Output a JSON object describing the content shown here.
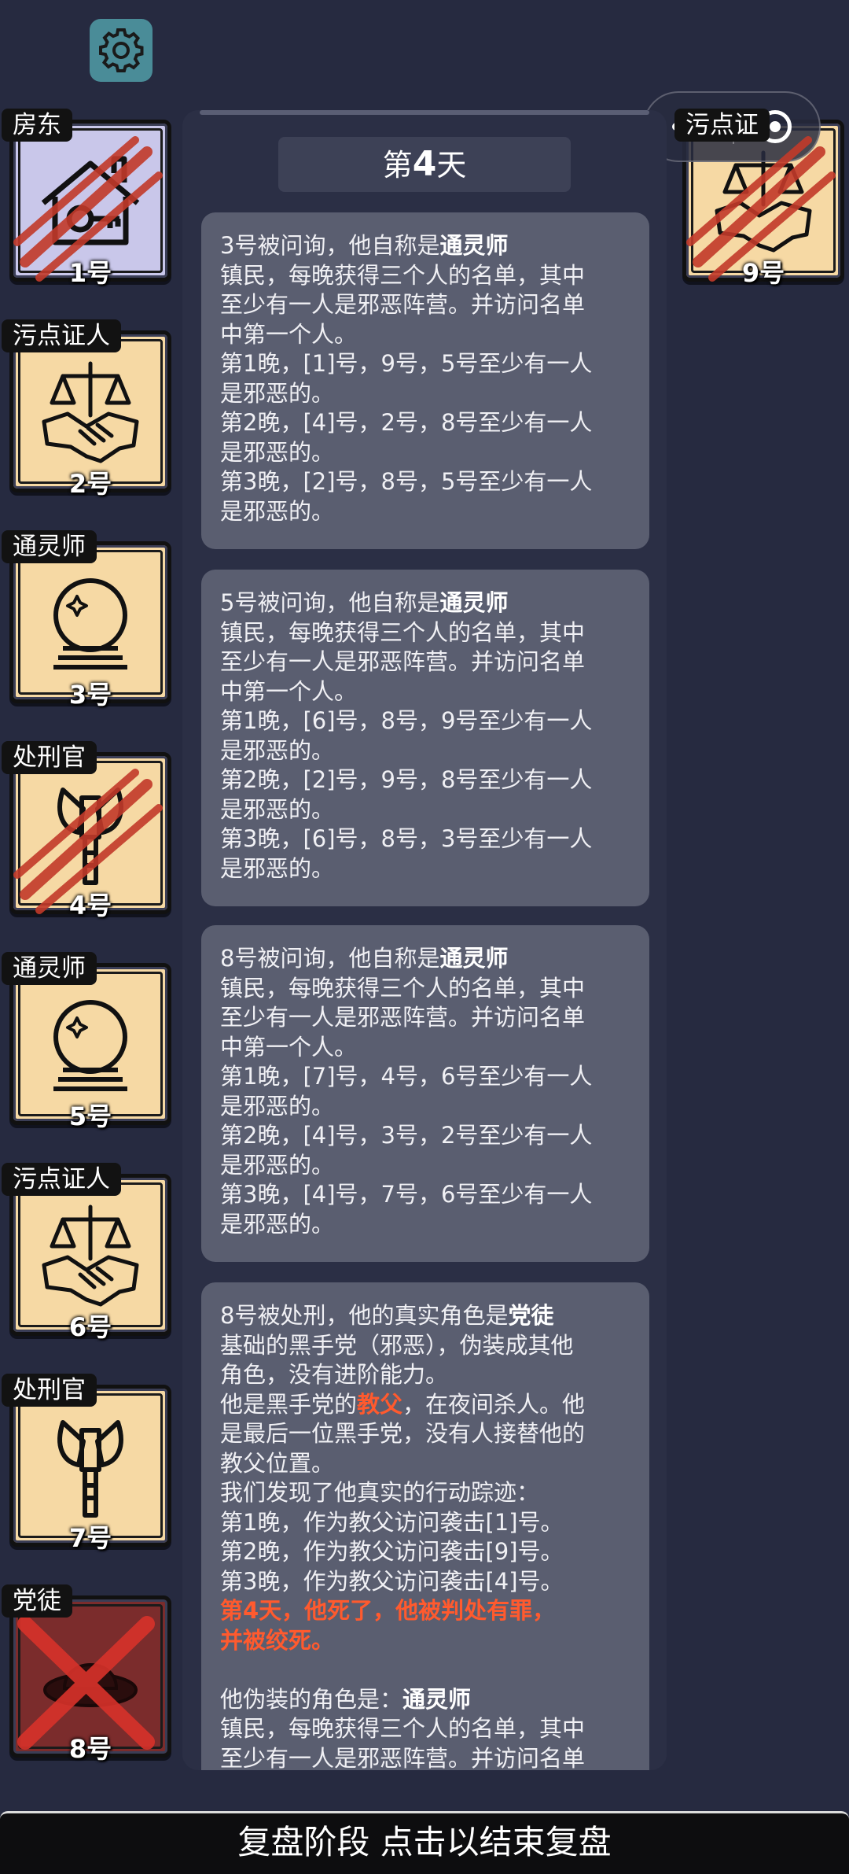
{
  "day_banner": {
    "prefix": "第",
    "day": "4",
    "suffix": "天"
  },
  "players": [
    {
      "role": "房东",
      "num": "1号",
      "icon": "house-key-icon",
      "dead": true
    },
    {
      "role": "污点证人",
      "num": "2号",
      "icon": "scales-handshake-icon",
      "dead": false
    },
    {
      "role": "通灵师",
      "num": "3号",
      "icon": "crystal-ball-icon",
      "dead": false
    },
    {
      "role": "处刑官",
      "num": "4号",
      "icon": "axe-icon",
      "dead": true
    },
    {
      "role": "通灵师",
      "num": "5号",
      "icon": "crystal-ball-icon",
      "dead": false
    },
    {
      "role": "污点证人",
      "num": "6号",
      "icon": "scales-handshake-icon",
      "dead": false
    },
    {
      "role": "处刑官",
      "num": "7号",
      "icon": "axe-icon",
      "dead": false
    },
    {
      "role": "党徒",
      "num": "8号",
      "icon": "hat-icon",
      "dead": true
    },
    {
      "role": "污点证",
      "num": "9号",
      "icon": "scales-handshake-icon",
      "dead": true
    }
  ],
  "messages": [
    {
      "lines": [
        {
          "pre": "3号被问询，他自称是",
          "bold": "通灵师"
        },
        {
          "text": "镇民，每晚获得三个人的名单，其中"
        },
        {
          "text": "至少有一人是邪恶阵营。并访问名单"
        },
        {
          "text": "中第一个人。"
        },
        {
          "text": "第1晚，[1]号，9号，5号至少有一人"
        },
        {
          "text": "是邪恶的。"
        },
        {
          "text": "第2晚，[4]号，2号，8号至少有一人"
        },
        {
          "text": "是邪恶的。"
        },
        {
          "text": "第3晚，[2]号，8号，5号至少有一人"
        },
        {
          "text": "是邪恶的。"
        }
      ]
    },
    {
      "lines": [
        {
          "pre": "5号被问询，他自称是",
          "bold": "通灵师"
        },
        {
          "text": "镇民，每晚获得三个人的名单，其中"
        },
        {
          "text": "至少有一人是邪恶阵营。并访问名单"
        },
        {
          "text": "中第一个人。"
        },
        {
          "text": "第1晚，[6]号，8号，9号至少有一人"
        },
        {
          "text": "是邪恶的。"
        },
        {
          "text": "第2晚，[2]号，9号，8号至少有一人"
        },
        {
          "text": "是邪恶的。"
        },
        {
          "text": "第3晚，[6]号，8号，3号至少有一人"
        },
        {
          "text": "是邪恶的。"
        }
      ]
    },
    {
      "lines": [
        {
          "pre": "8号被问询，他自称是",
          "bold": "通灵师"
        },
        {
          "text": "镇民，每晚获得三个人的名单，其中"
        },
        {
          "text": "至少有一人是邪恶阵营。并访问名单"
        },
        {
          "text": "中第一个人。"
        },
        {
          "text": "第1晚，[7]号，4号，6号至少有一人"
        },
        {
          "text": "是邪恶的。"
        },
        {
          "text": "第2晚，[4]号，3号，2号至少有一人"
        },
        {
          "text": "是邪恶的。"
        },
        {
          "text": "第3晚，[4]号，7号，6号至少有一人"
        },
        {
          "text": "是邪恶的。"
        }
      ]
    },
    {
      "lines": [
        {
          "pre": "8号被处刑，他的真实角色是",
          "bold": "党徒"
        },
        {
          "text": "基础的黑手党（邪恶），伪装成其他"
        },
        {
          "text": "角色，没有进阶能力。"
        },
        {
          "pre": "他是黑手党的",
          "red": "教父",
          "post": "，在夜间杀人。他"
        },
        {
          "text": "是最后一位黑手党，没有人接替他的"
        },
        {
          "text": "教父位置。"
        },
        {
          "text": "我们发现了他真实的行动踪迹："
        },
        {
          "text": "第1晚，作为教父访问袭击[1]号。"
        },
        {
          "text": "第2晚，作为教父访问袭击[9]号。"
        },
        {
          "text": "第3晚，作为教父访问袭击[4]号。"
        },
        {
          "red": "第4天，他死了，他被判处有罪，"
        },
        {
          "red": "并被绞死。"
        },
        {
          "text": ""
        },
        {
          "pre": "他伪装的角色是：",
          "bold": "通灵师"
        },
        {
          "text": "镇民，每晚获得三个人的名单，其中"
        },
        {
          "text": "至少有一人是邪恶阵营。并访问名单"
        }
      ]
    }
  ],
  "bottom_bar": {
    "label": "复盘阶段 点击以结束复盘"
  }
}
